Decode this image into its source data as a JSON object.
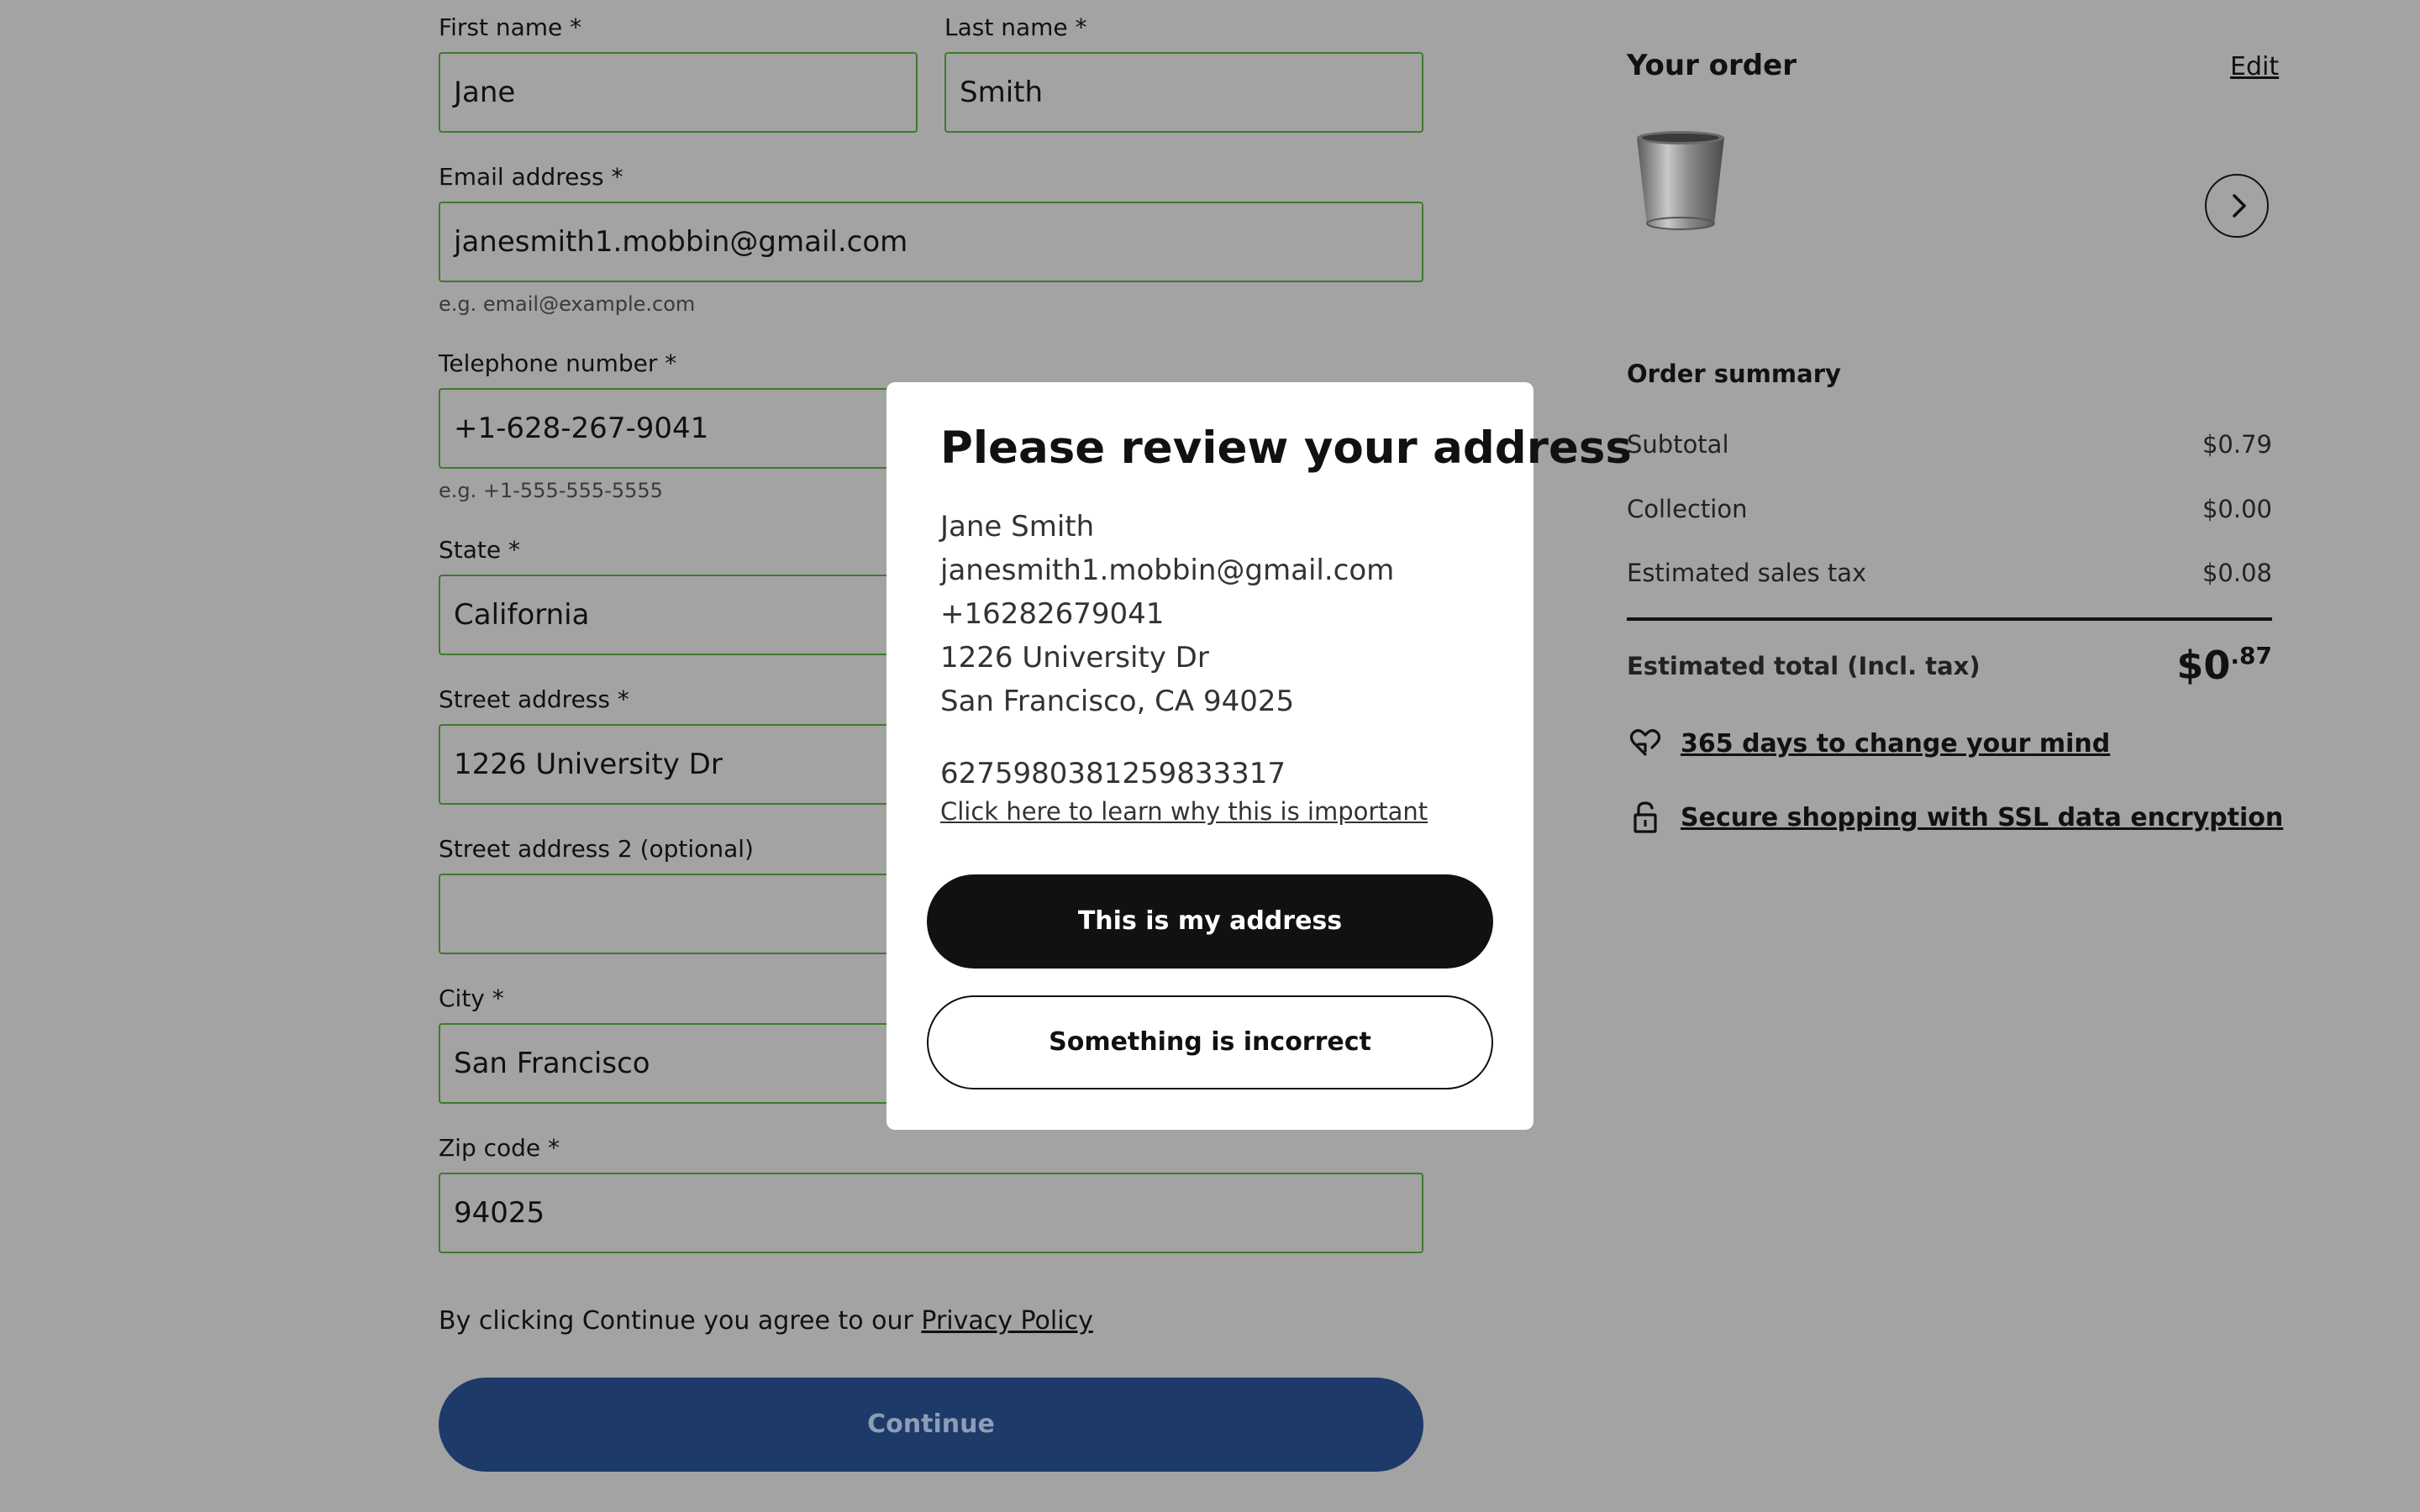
{
  "form": {
    "first_name": {
      "label": "First name *",
      "value": "Jane"
    },
    "last_name": {
      "label": "Last name *",
      "value": "Smith"
    },
    "email": {
      "label": "Email address *",
      "value": "janesmith1.mobbin@gmail.com",
      "helper": "e.g. email@example.com"
    },
    "telephone": {
      "label": "Telephone number *",
      "value": "+1-628-267-9041",
      "helper": "e.g. +1-555-555-5555"
    },
    "state": {
      "label": "State *",
      "value": "California"
    },
    "street": {
      "label": "Street address *",
      "value": "1226 University Dr"
    },
    "street2": {
      "label": "Street address 2 (optional)",
      "value": ""
    },
    "city": {
      "label": "City *",
      "value": "San Francisco"
    },
    "zip": {
      "label": "Zip code *",
      "value": "94025"
    },
    "agree_text": "By clicking Continue you agree to our ",
    "privacy_link": "Privacy Policy",
    "continue_label": "Continue"
  },
  "order": {
    "title": "Your order",
    "edit_label": "Edit",
    "summary_title": "Order summary",
    "rows": [
      {
        "label": "Subtotal",
        "value": "$0.79"
      },
      {
        "label": "Collection",
        "value": "$0.00"
      },
      {
        "label": "Estimated sales tax",
        "value": "$0.08"
      }
    ],
    "total_label": "Estimated total (Incl. tax)",
    "total_main": "$0",
    "total_cents": ".87",
    "perks": [
      {
        "text": "365 days to change your mind",
        "icon": "heart-return-icon"
      },
      {
        "text": "Secure shopping with SSL data encryption",
        "icon": "lock-icon"
      }
    ]
  },
  "modal": {
    "title": "Please review your address",
    "address_lines": [
      "Jane Smith",
      "janesmith1.mobbin@gmail.com",
      "+16282679041",
      "1226 University Dr",
      "San Francisco, CA 94025"
    ],
    "reference": "6275980381259833317",
    "learn_link": "Click here to learn why this is important",
    "confirm_label": "This is my address",
    "incorrect_label": "Something is incorrect"
  },
  "colors": {
    "overlay_bg": "#a3a3a3",
    "input_border": "#3f7a2d",
    "continue_bg": "#1d3a68",
    "primary_btn": "#111111"
  }
}
